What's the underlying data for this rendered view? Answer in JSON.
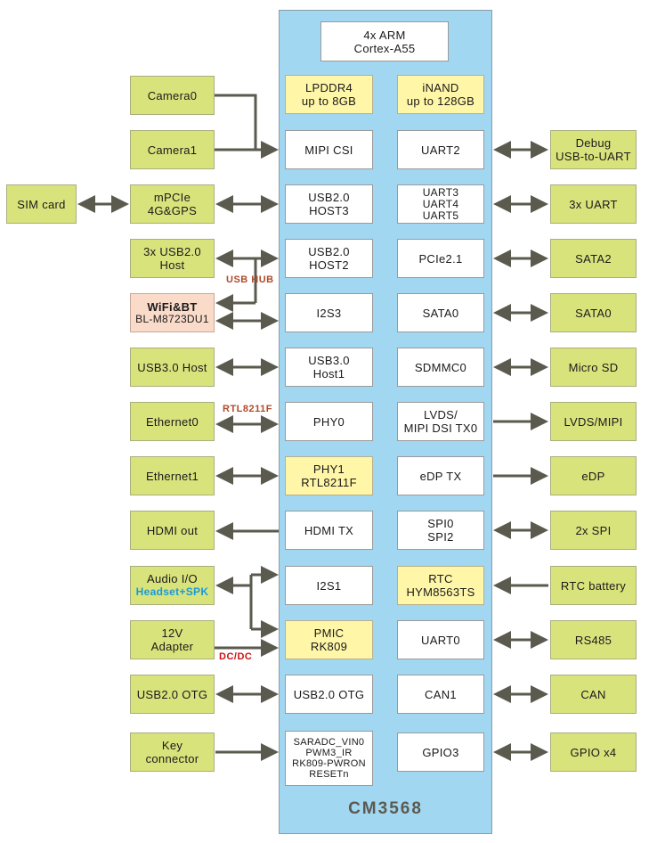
{
  "soc": {
    "name": "CM3568",
    "cpu": [
      "4x ARM",
      "Cortex-A55"
    ],
    "memory": [
      "LPDDR4",
      "up to 8GB"
    ],
    "storage": [
      "iNAND",
      "up to 128GB"
    ],
    "left_interfaces": [
      [
        "MIPI CSI"
      ],
      [
        "USB2.0",
        "HOST3"
      ],
      [
        "USB2.0",
        "HOST2"
      ],
      [
        "I2S3"
      ],
      [
        "USB3.0",
        "Host1"
      ],
      [
        "PHY0"
      ],
      [
        "PHY1",
        "RTL8211F"
      ],
      [
        "HDMI TX"
      ],
      [
        "I2S1"
      ],
      [
        "PMIC",
        "RK809"
      ],
      [
        "USB2.0 OTG"
      ],
      [
        "SARADC_VIN0",
        "PWM3_IR",
        "RK809-PWRON",
        "RESETn"
      ]
    ],
    "right_interfaces": [
      [
        "UART2"
      ],
      [
        "UART3",
        "UART4",
        "UART5"
      ],
      [
        "PCIe2.1"
      ],
      [
        "SATA0"
      ],
      [
        "SDMMC0"
      ],
      [
        "LVDS/",
        "MIPI DSI TX0"
      ],
      [
        "eDP TX"
      ],
      [
        "SPI0",
        "SPI2"
      ],
      [
        "RTC",
        "HYM8563TS"
      ],
      [
        "UART0"
      ],
      [
        "CAN1"
      ],
      [
        "GPIO3"
      ]
    ]
  },
  "left_peripherals": [
    [
      "Camera0"
    ],
    [
      "Camera1"
    ],
    [
      "mPCIe",
      "4G&GPS"
    ],
    [
      "3x USB2.0",
      "Host"
    ],
    [
      "WiFi&BT",
      "BL-M8723DU1"
    ],
    [
      "USB3.0 Host"
    ],
    [
      "Ethernet0"
    ],
    [
      "Ethernet1"
    ],
    [
      "HDMI out"
    ],
    [
      "Audio I/O",
      "Headset+SPK"
    ],
    [
      "12V",
      "Adapter"
    ],
    [
      "USB2.0 OTG"
    ],
    [
      "Key",
      "connector"
    ]
  ],
  "far_left_peripherals": [
    [
      "SIM card"
    ]
  ],
  "right_peripherals": [
    [
      "Debug",
      "USB-to-UART"
    ],
    [
      "3x UART"
    ],
    [
      "SATA2"
    ],
    [
      "SATA0"
    ],
    [
      "Micro SD"
    ],
    [
      "LVDS/MIPI"
    ],
    [
      "eDP"
    ],
    [
      "2x SPI"
    ],
    [
      "RTC battery"
    ],
    [
      "RS485"
    ],
    [
      "CAN"
    ],
    [
      "GPIO x4"
    ]
  ],
  "annotations": {
    "usb_hub": "USB  HUB",
    "rtl8211f": "RTL8211F",
    "dc_dc": "DC/DC"
  },
  "colors": {
    "peripheral": "#d9e37c",
    "wifi_peripheral": "#fadbc9",
    "soc_body": "#a2d7f2",
    "soc_highlight": "#fff6a8",
    "wire": "#5a5a4e",
    "annotation_red": "#b04a2a",
    "dcdc_red": "#cc1111",
    "headset_blue": "#1a9ad8"
  }
}
